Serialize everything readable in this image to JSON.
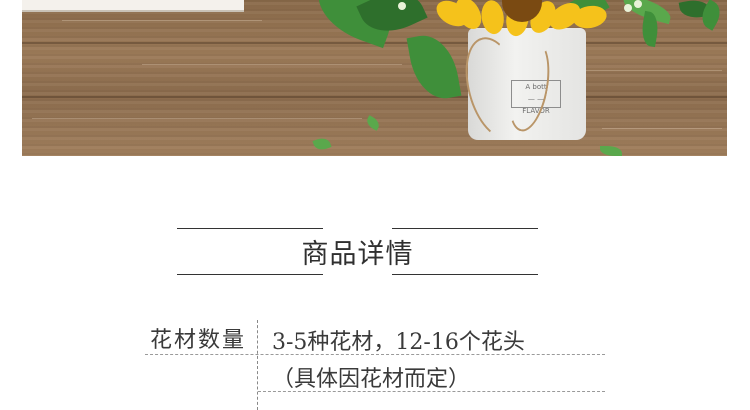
{
  "photo": {
    "vase_label": {
      "line1": "A bott",
      "line2": "— —",
      "line3": "FLAVOR"
    }
  },
  "section": {
    "title": "商品详情"
  },
  "details": {
    "rows": [
      {
        "label": "花材数量",
        "value": "3-5种花材，12-16个花头"
      },
      {
        "label": "",
        "value": "（具体因花材而定）"
      }
    ]
  },
  "colors": {
    "text": "#333333",
    "rule": "#333333",
    "dash": "#888888",
    "wood": "#9c7a58",
    "sunflower": "#f5c21b",
    "leaf": "#3f8f3a"
  }
}
